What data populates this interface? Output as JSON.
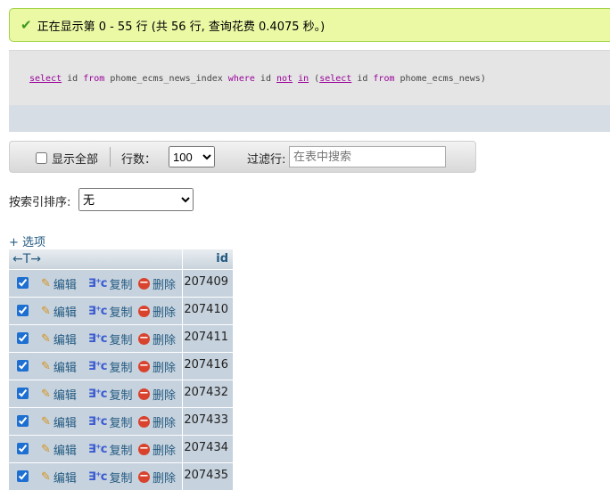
{
  "message": {
    "text": "正在显示第 0 - 55 行 (共 56 行, 查询花费 0.4075 秒。)"
  },
  "sql": {
    "tokens": [
      {
        "t": "select",
        "c": "kwu"
      },
      {
        "t": " id ",
        "c": ""
      },
      {
        "t": "from",
        "c": "kw"
      },
      {
        "t": " phome_ecms_news_index ",
        "c": ""
      },
      {
        "t": "where",
        "c": "kw"
      },
      {
        "t": " id ",
        "c": ""
      },
      {
        "t": "not",
        "c": "kwu"
      },
      {
        "t": " ",
        "c": ""
      },
      {
        "t": "in",
        "c": "kwu"
      },
      {
        "t": " (",
        "c": ""
      },
      {
        "t": "select",
        "c": "kwu"
      },
      {
        "t": " id ",
        "c": ""
      },
      {
        "t": "from",
        "c": "kw"
      },
      {
        "t": " phome_ecms_news)",
        "c": ""
      }
    ]
  },
  "navbar": {
    "show_all_label": "显示全部",
    "rows_label": "行数：",
    "rows_value": "100",
    "filter_label": "过滤行:",
    "filter_placeholder": "在表中搜索"
  },
  "sort": {
    "label": "按索引排序:",
    "value": "无"
  },
  "options_link": "+ 选项",
  "table": {
    "header_arrows": "←T→",
    "column": "id",
    "actions": {
      "edit": "编辑",
      "copy": "复制",
      "delete": "删除"
    },
    "rows": [
      "207409",
      "207410",
      "207411",
      "207416",
      "207432",
      "207433",
      "207434",
      "207435"
    ]
  }
}
